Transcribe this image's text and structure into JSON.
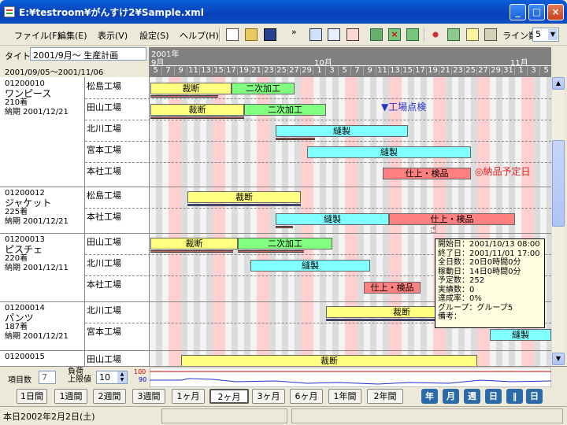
{
  "window": {
    "title": "E:¥testroom¥がんすけ2¥Sample.xml"
  },
  "menu": [
    "ファイル(F)",
    "編集(E)",
    "表示(V)",
    "設定(S)",
    "ヘルプ(H)"
  ],
  "toolbar": {
    "overflow": "»",
    "lines_label": "ライン数",
    "lines_value": "5"
  },
  "header": {
    "title_label": "タイトル",
    "title_value": "2001/9月～ 生産計画",
    "period": "2001/09/05～2001/11/06",
    "year": "2001年",
    "months": [
      "9月",
      "10月",
      "11月"
    ],
    "days": [
      "5",
      "7",
      "9",
      "11",
      "13",
      "15",
      "17",
      "19",
      "21",
      "23",
      "25",
      "27",
      "29",
      "1",
      "3",
      "5",
      "7",
      "9",
      "11",
      "13",
      "15",
      "17",
      "19",
      "21",
      "23",
      "25",
      "27",
      "29",
      "31",
      "1",
      "3",
      "5"
    ]
  },
  "rows": [
    {
      "code": "01200010",
      "name": "ワンピース",
      "qty": "210着",
      "due": "納期 2001/12/21",
      "factories": [
        "松島工場",
        "田山工場",
        "北川工場",
        "宮本工場",
        "本社工場"
      ]
    },
    {
      "code": "01200012",
      "name": "ジャケット",
      "qty": "225着",
      "due": "納期 2001/12/21",
      "factories": [
        "松島工場",
        "本社工場"
      ]
    },
    {
      "code": "01200013",
      "name": "ピスチェ",
      "qty": "220着",
      "due": "納期 2001/12/11",
      "factories": [
        "田山工場",
        "北川工場",
        "本社工場"
      ]
    },
    {
      "code": "01200014",
      "name": "パンツ",
      "qty": "187着",
      "due": "納期 2001/12/21",
      "factories": [
        "北川工場",
        "宮本工場"
      ]
    },
    {
      "code": "01200015",
      "name": "",
      "qty": "",
      "due": "",
      "factories": [
        "田山工場"
      ]
    }
  ],
  "tasks": {
    "cut": "裁断",
    "second": "二次加工",
    "sew": "縫製",
    "finish": "仕上・検品"
  },
  "annotations": {
    "inspection": "▼工場点検",
    "due_mark": "◎納品予定日"
  },
  "tooltip": {
    "start": "開始日：2001/10/13 08:00",
    "end": "終了日：2001/11/01 17:00",
    "total_days": "全日数：20日0時間0分",
    "work_days": "稼動日：14日0時間0分",
    "planned": "予定数：252",
    "actual": "実績数：0",
    "rate": "達成率：0%",
    "group": "グループ：グループ5",
    "note": "備考："
  },
  "bottom": {
    "item_count_label": "項目数",
    "item_count_value": "7",
    "load_label_1": "負荷",
    "load_label_2": "上限値",
    "load_value": "10",
    "load_top": "100",
    "load_mid": "90",
    "ranges": [
      "1日間",
      "1週間",
      "2週間",
      "3週間",
      "1ヶ月",
      "2ヶ月",
      "3ヶ月",
      "6ヶ月",
      "1年間",
      "2年間"
    ],
    "active_range": "2ヶ月",
    "nav": [
      "年",
      "月",
      "週",
      "日",
      "‖",
      "日"
    ]
  },
  "status": {
    "text": "本日2002年2月2日(土)"
  },
  "colors": {
    "cut": "#ffff80",
    "second": "#80ff80",
    "sew": "#80ffff",
    "finish": "#ff8080",
    "header": "#808080",
    "weekend": "#ffd0d0"
  }
}
